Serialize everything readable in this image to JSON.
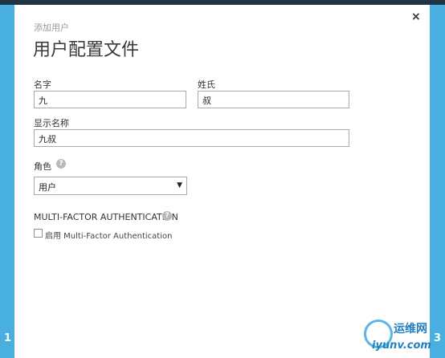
{
  "wizard": {
    "step_left": "1",
    "step_right": "3"
  },
  "dialog": {
    "close_glyph": "×",
    "subtitle": "添加用户",
    "title": "用户配置文件"
  },
  "form": {
    "first_name_label": "名字",
    "first_name_value": "九",
    "last_name_label": "姓氏",
    "last_name_value": "叔",
    "display_name_label": "显示名称",
    "display_name_value": "九叔",
    "role_label": "角色",
    "role_help_glyph": "?",
    "role_value": "用户",
    "role_arrow": "▼",
    "mfa_heading": "MULTI-FACTOR AUTHENTICATION",
    "mfa_help_glyph": "?",
    "mfa_checkbox_label": "启用 Multi-Factor Authentication",
    "mfa_enabled": false
  },
  "watermark": {
    "brand_cn": "运维网",
    "brand_domain": "iyunv.com"
  },
  "colors": {
    "accent": "#3fa3d8",
    "strip": "#49aee0",
    "top_bar": "#1e3344"
  }
}
